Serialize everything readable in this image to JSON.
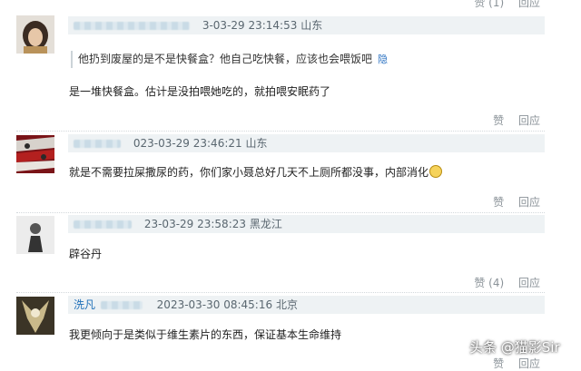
{
  "top_actions": {
    "like_label": "赞 (1)",
    "reply_label": "回应"
  },
  "comments": [
    {
      "user_name": "",
      "timestamp": "3-03-29 23:14:53",
      "location": "山东",
      "quote_text": "他扔到废屋的是不是快餐盒？他自己吃快餐，应该也会喂饭吧",
      "quote_link": "隐",
      "text": "是一堆快餐盒。估计是没拍喂她吃的，就拍喂安眠药了",
      "like_label": "赞",
      "reply_label": "回应"
    },
    {
      "user_name": "",
      "timestamp": "023-03-29 23:46:21",
      "location": "山东",
      "text": "就是不需要拉屎撒尿的药，你们家小聂总好几天不上厕所都没事，内部消化",
      "like_label": "赞",
      "reply_label": "回应"
    },
    {
      "user_name": "",
      "timestamp": "23-03-29 23:58:23",
      "location": "黑龙江",
      "text": "辟谷丹",
      "like_label": "赞 (4)",
      "reply_label": "回应"
    },
    {
      "user_name": "洗凡",
      "timestamp": "2023-03-30 08:45:16",
      "location": "北京",
      "text": "我更倾向于是类似于维生素片的东西，保证基本生命维持",
      "like_label": "赞",
      "reply_label": "回应"
    }
  ],
  "watermark": "头条 @猫影Sir"
}
